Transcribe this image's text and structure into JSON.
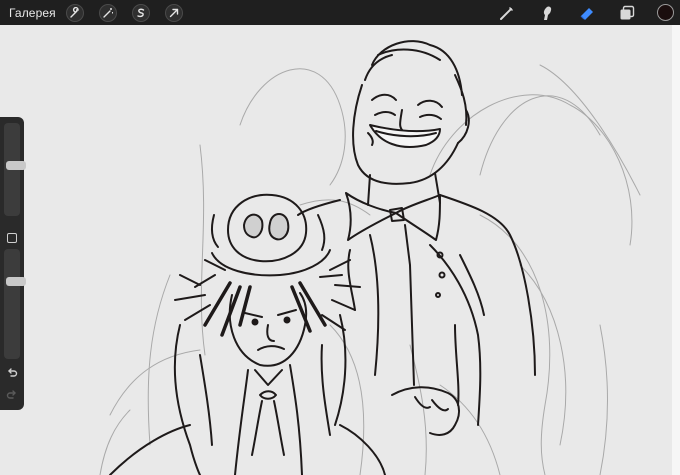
{
  "topbar": {
    "gallery_label": "Галерея",
    "left_tools": [
      "wrench-icon",
      "magic-wand-icon",
      "selection-icon",
      "transform-arrow-icon"
    ],
    "right_tools": [
      "brush-icon",
      "smudge-icon",
      "eraser-icon",
      "layers-icon"
    ],
    "active_tool": "eraser-icon",
    "current_color": "#1a0e0e"
  },
  "sidebar": {
    "brush_size_level": 0.55,
    "opacity_level": 0.72
  },
  "colors": {
    "active_tool": "#3f8cff",
    "toolbar_bg": "#1f1f1f",
    "canvas_bg": "#e9e9e9"
  }
}
